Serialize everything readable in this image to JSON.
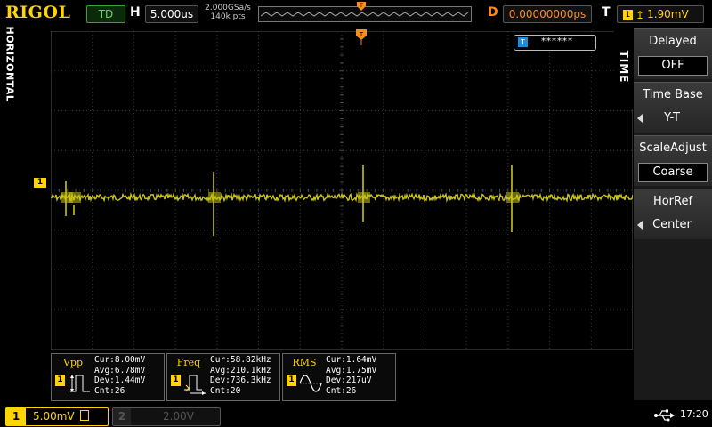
{
  "brand": "RIGOL",
  "status": {
    "run_state": "TD",
    "run_color": "#55e055"
  },
  "horizontal": {
    "letter": "H",
    "timebase": "5.000us",
    "sample_rate": "2.000GSa/s",
    "points": "140k pts",
    "delay_letter": "D",
    "delay": "0.00000000ps"
  },
  "trigger": {
    "letter": "T",
    "source": "1",
    "edge_icon": "rising-edge-icon",
    "level": "1.90mV",
    "tag_value": "******"
  },
  "side_label": "HORIZONTAL",
  "channel_marker": "1",
  "menu": {
    "tab": "TIME",
    "items": [
      {
        "label": "Delayed",
        "value": "OFF"
      },
      {
        "label": "Time Base",
        "value": "Y-T"
      },
      {
        "label": "ScaleAdjust",
        "value": "Coarse"
      },
      {
        "label": "HorRef",
        "value": "Center"
      }
    ]
  },
  "measurements": [
    {
      "name": "Vpp",
      "source": "1",
      "cur": "Cur:8.00mV",
      "avg": "Avg:6.78mV",
      "dev": "Dev:1.44mV",
      "cnt": "Cnt:26"
    },
    {
      "name": "Freq",
      "source": "1",
      "cur": "Cur:58.82kHz",
      "avg": "Avg:210.1kHz",
      "dev": "Dev:736.3kHz",
      "cnt": "Cnt:20"
    },
    {
      "name": "RMS",
      "source": "1",
      "cur": "Cur:1.64mV",
      "avg": "Avg:1.75mV",
      "dev": "Dev:217uV",
      "cnt": "Cnt:26"
    }
  ],
  "channels": [
    {
      "number": "1",
      "scale": "5.00mV",
      "active": true,
      "color": "#ffd400"
    },
    {
      "number": "2",
      "scale": "2.00V",
      "active": false,
      "color": "#555555"
    }
  ],
  "clock": "17:20",
  "colors": {
    "trace": "#c9c31a",
    "brand": "#ffd400",
    "delay": "#ff8c1a",
    "trigger_tag": "#1c8fd8"
  }
}
